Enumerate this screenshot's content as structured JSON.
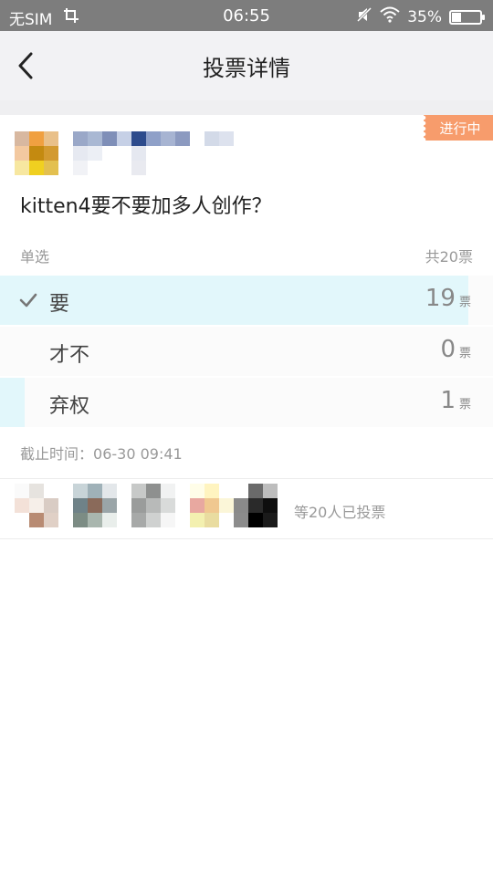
{
  "status_bar": {
    "carrier": "无SIM",
    "time": "06:55",
    "battery": "35%"
  },
  "nav": {
    "title": "投票详情"
  },
  "poll": {
    "status_badge": "进行中",
    "question": "kitten4要不要加多人创作？",
    "mode": "单选",
    "total": "共20票",
    "options": [
      {
        "label": "要",
        "count": "19",
        "unit": "票",
        "share": 0.95,
        "selected": true
      },
      {
        "label": "才不",
        "count": "0",
        "unit": "票",
        "share": 0.0,
        "selected": false
      },
      {
        "label": "弃权",
        "count": "1",
        "unit": "票",
        "share": 0.05,
        "selected": false
      }
    ],
    "deadline_label": "截止时间：",
    "deadline_value": "06-30 09:41",
    "voters_text": "等20人已投票"
  },
  "colors": {
    "accent_bar": "#e2f7fb",
    "badge": "#f79c6c",
    "status_bar": "#7d7d7d"
  }
}
